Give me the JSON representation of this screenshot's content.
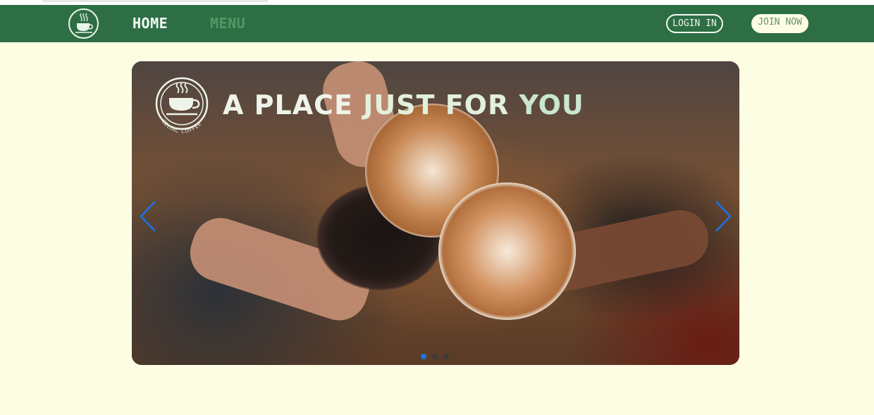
{
  "nav": {
    "home_label": "HOME",
    "menu_label": "MENU",
    "login_label": "LOGIN IN",
    "join_label": "JOIN NOW",
    "logo_icon": "coffee-cup-icon"
  },
  "carousel": {
    "brand_badge_text": "CELIAC COFFEE",
    "headline_part1": "A PLACE ",
    "headline_part2": "JUST ",
    "headline_part3": "FOR ",
    "headline_part4": "YOU",
    "prev_icon": "chevron-left-icon",
    "next_icon": "chevron-right-icon",
    "slide_count": 3,
    "active_slide": 1,
    "accent_color": "#1a73e8"
  },
  "colors": {
    "navbar_bg": "#2e6e45",
    "page_bg": "#fdfde3"
  }
}
